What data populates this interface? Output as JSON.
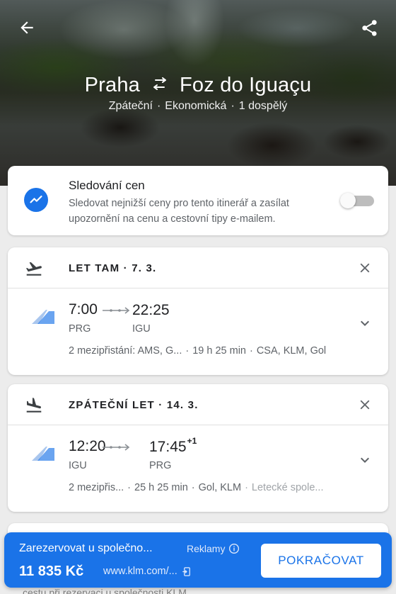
{
  "header": {
    "origin": "Praha",
    "destination": "Foz do Iguaçu",
    "trip_type": "Zpáteční",
    "cabin": "Ekonomická",
    "passengers": "1 dospělý",
    "dot": "·"
  },
  "price_tracking": {
    "title": "Sledování cen",
    "description": "Sledovat nejnižší ceny pro tento itinerář a zasílat upozornění na cenu a cestovní tipy e-mailem.",
    "enabled": false
  },
  "outbound": {
    "title": "LET TAM · 7. 3.",
    "dep_time": "7:00",
    "arr_time": "22:25",
    "arr_day_offset": "",
    "dep_code": "PRG",
    "arr_code": "IGU",
    "stops": "2 mezipřistání: AMS, G...",
    "duration": "19 h 25 min",
    "airlines": "CSA, KLM, Gol",
    "extra": ""
  },
  "return": {
    "title": "ZPÁTEČNÍ LET · 14. 3.",
    "dep_time": "12:20",
    "arr_time": "17:45",
    "arr_day_offset": "+1",
    "dep_code": "IGU",
    "arr_code": "PRG",
    "stops": "2 mezipřis...",
    "duration": "25 h 25 min",
    "airlines": "Gol, KLM",
    "extra": "Letecké spole..."
  },
  "booking": {
    "label": "Zarezervovat u společno...",
    "ads_label": "Reklamy",
    "price": "11 835 Kč",
    "site": "www.klm.com/...",
    "button": "POKRAČOVAT",
    "below_text": "cestu při rezervaci u společnosti KLM"
  },
  "colors": {
    "accent": "#1a73e8",
    "text_secondary": "#5f6368"
  },
  "icons": {
    "back": "arrow-left-icon",
    "share": "share-icon",
    "swap": "swap-arrows-icon",
    "trend": "trending-icon",
    "takeoff": "takeoff-icon",
    "landing": "landing-icon",
    "close": "close-icon",
    "expand": "chevron-down-icon",
    "airline": "airline-logo",
    "info": "info-icon",
    "external": "external-link-icon"
  }
}
